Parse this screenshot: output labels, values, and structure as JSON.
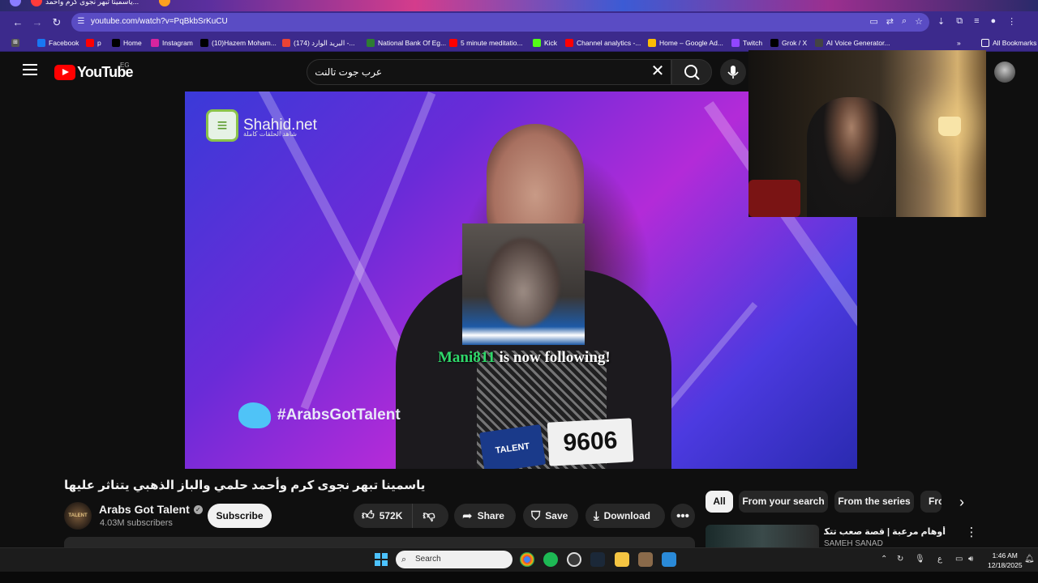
{
  "browser": {
    "tab_title": "ياسمينا تبهر نجوى كرم وأحمد...",
    "url": "youtube.com/watch?v=PqBkbSrKuCU",
    "bookmarks": [
      {
        "label": "Facebook",
        "icon": "facebook-icon",
        "color": "#1877f2"
      },
      {
        "label": "p",
        "icon": "youtube-icon",
        "color": "#ff0000"
      },
      {
        "label": "Home",
        "icon": "x-icon",
        "color": "#000000"
      },
      {
        "label": "Instagram",
        "icon": "instagram-icon",
        "color": "#d6249f"
      },
      {
        "label": "(10)Hazem Moham...",
        "icon": "tiktok-icon",
        "color": "#000000"
      },
      {
        "label": "(174) البريد الوارد -...",
        "icon": "gmail-icon",
        "color": "#ea4335"
      },
      {
        "label": "National Bank Of Eg...",
        "icon": "bank-icon",
        "color": "#2e7d32"
      },
      {
        "label": "5 minute meditatio...",
        "icon": "youtube-icon",
        "color": "#ff0000"
      },
      {
        "label": "Kick",
        "icon": "kick-icon",
        "color": "#53fc18"
      },
      {
        "label": "Channel analytics -...",
        "icon": "youtube-icon",
        "color": "#ff0000"
      },
      {
        "label": "Home – Google Ad...",
        "icon": "google-ads-icon",
        "color": "#fbbc04"
      },
      {
        "label": "Twitch",
        "icon": "twitch-icon",
        "color": "#9146ff"
      },
      {
        "label": "Grok / X",
        "icon": "x-icon",
        "color": "#000000"
      },
      {
        "label": "AI Voice Generator...",
        "icon": "ai-icon",
        "color": "#444444"
      }
    ],
    "all_bookmarks": "All Bookmarks"
  },
  "youtube": {
    "logo": "YouTube",
    "country": "EG",
    "search_query": "عرب جوت تالنت"
  },
  "video": {
    "watermark": "Shahid.net",
    "watermark_sub": "شاهد الحلقات كاملة",
    "hashtag": "#ArabsGotTalent",
    "contestant_number": "9606",
    "badge_text": "TALENT"
  },
  "overlay": {
    "follower_name": "Mani811",
    "follow_message": "is now following!"
  },
  "details": {
    "title": "ياسمينا تبهر نجوى كرم وأحمد حلمي والباز الذهبي يتناثر عليها",
    "channel": "Arabs Got Talent",
    "subscribers": "4.03M subscribers",
    "channel_avatar_text": "TALENT",
    "subscribe": "Subscribe",
    "likes": "572K",
    "share": "Share",
    "save": "Save",
    "download": "Download"
  },
  "chips": [
    "All",
    "From your search",
    "From the series",
    "Fro"
  ],
  "recommendation": {
    "title": "أوهام مرعبة | قصة صعب تتكرر كثير",
    "channel": "SAMEH SANAD"
  },
  "taskbar": {
    "search_placeholder": "Search",
    "language": "ع",
    "time": "1:46 AM",
    "date": "12/18/2025"
  }
}
